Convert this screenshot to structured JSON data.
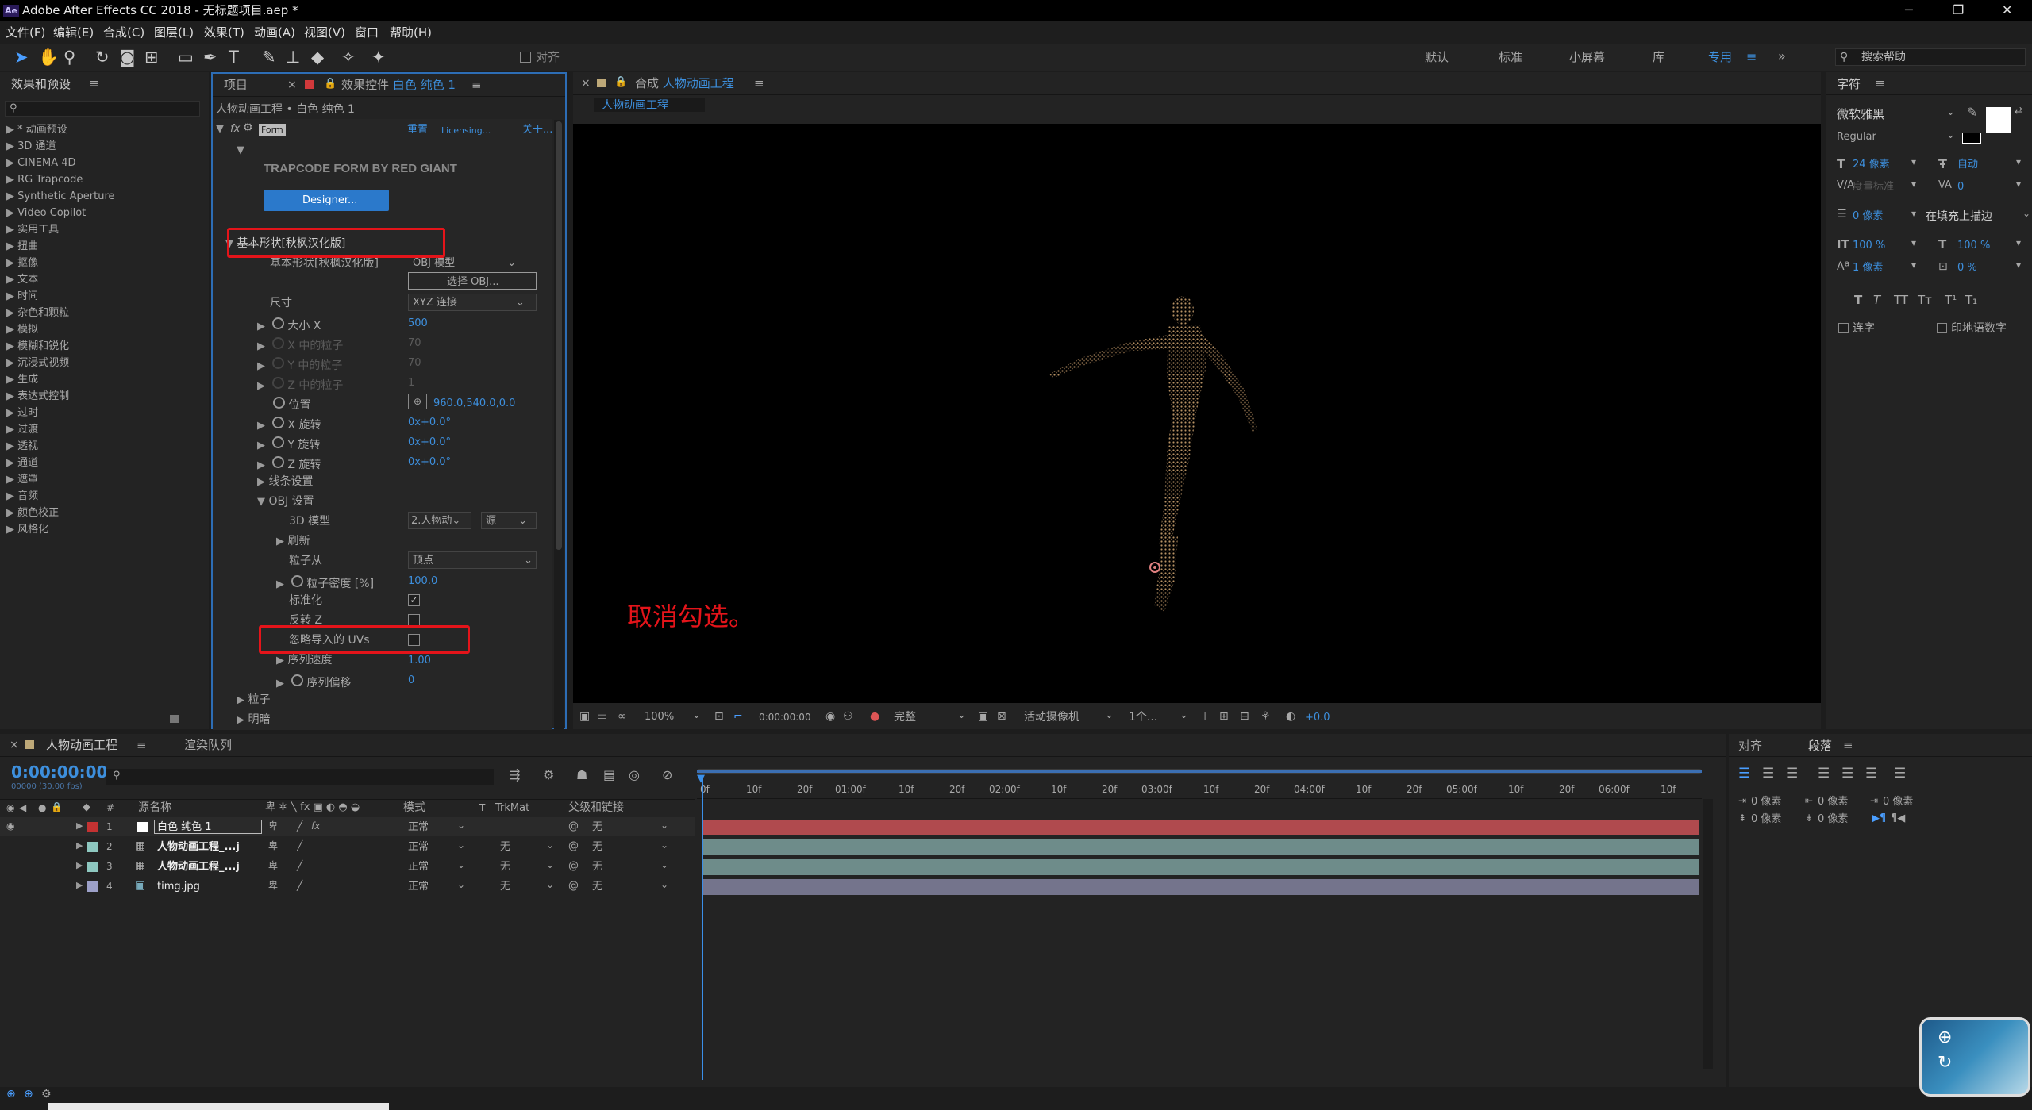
{
  "window": {
    "app_icon": "Ae",
    "title": "Adobe After Effects CC 2018 - 无标题项目.aep *",
    "minimize": "─",
    "maximize": "❐",
    "close": "✕"
  },
  "menu": [
    "文件(F)",
    "编辑(E)",
    "合成(C)",
    "图层(L)",
    "效果(T)",
    "动画(A)",
    "视图(V)",
    "窗口",
    "帮助(H)"
  ],
  "toolbar": {
    "align_label": "对齐",
    "workspaces": [
      "默认",
      "标准",
      "小屏幕",
      "库",
      "专用"
    ],
    "search_placeholder": "搜索帮助"
  },
  "effects_panel": {
    "title": "效果和预设",
    "categories": [
      "* 动画预设",
      "3D 通道",
      "CINEMA 4D",
      "RG Trapcode",
      "Synthetic Aperture",
      "Video Copilot",
      "实用工具",
      "扭曲",
      "抠像",
      "文本",
      "时间",
      "杂色和颗粒",
      "模拟",
      "模糊和锐化",
      "沉浸式视频",
      "生成",
      "表达式控制",
      "过时",
      "过渡",
      "透视",
      "通道",
      "遮罩",
      "音频",
      "颜色校正",
      "风格化"
    ]
  },
  "fx_panel": {
    "tab_project": "项目",
    "tab_effect": "效果控件",
    "tab_effect_layer": "白色 纯色 1",
    "breadcrumb": "人物动画工程 • 白色 纯色 1",
    "fx_label": "fx",
    "effect_name": "Form",
    "reset": "重置",
    "licensing": "Licensing...",
    "about": "关于...",
    "brand": "TRAPCODE FORM BY RED GIANT",
    "designer_button": "Designer...",
    "rows": {
      "base_form": "基本形状[秋枫汉化版]",
      "base_form_prop": "基本形状[秋枫汉化版]",
      "base_form_value": "OBJ 模型",
      "choose_obj": "选择 OBJ...",
      "size": "尺寸",
      "size_value": "XYZ 连接",
      "size_x": "大小 X",
      "size_x_value": "500",
      "px_x": "X 中的粒子",
      "px_x_value": "70",
      "px_y": "Y 中的粒子",
      "px_y_value": "70",
      "px_z": "Z 中的粒子",
      "px_z_value": "1",
      "position": "位置",
      "position_value": "960.0,540.0,0.0",
      "rot_x": "X 旋转",
      "rot_x_value": "0x+0.0°",
      "rot_y": "Y 旋转",
      "rot_y_value": "0x+0.0°",
      "rot_z": "Z 旋转",
      "rot_z_value": "0x+0.0°",
      "string_settings": "线条设置",
      "obj_settings": "OBJ 设置",
      "model_3d": "3D 模型",
      "model_3d_value": "2.人物动",
      "model_3d_source": "源",
      "refresh": "刷新",
      "particles_from": "粒子从",
      "particles_from_value": "顶点",
      "density": "粒子密度 [%]",
      "density_value": "100.0",
      "normalize": "标准化",
      "invert_z": "反转 Z",
      "ignore_uvs": "忽略导入的 UVs",
      "seq_speed": "序列速度",
      "seq_speed_value": "1.00",
      "seq_offset": "序列偏移",
      "seq_offset_value": "0",
      "particle": "粒子",
      "shading": "明暗"
    }
  },
  "comp_panel": {
    "tab_prefix": "合成",
    "comp_name": "人物动画工程",
    "comp_chip": "人物动画工程",
    "annotation": "取消勾选。",
    "zoom": "100%",
    "timecode": "0:00:00:00",
    "quality": "完整",
    "camera": "活动摄像机",
    "views": "1个...",
    "exposure": "+0.0"
  },
  "char_panel": {
    "title": "字符",
    "font": "微软雅黑",
    "style": "Regular",
    "size": "24 像素",
    "leading": "自动",
    "kerning": "度量标准",
    "tracking": "0",
    "stroke": "0 像素",
    "stroke_mode": "在填充上描边",
    "vscale": "100 %",
    "hscale": "100 %",
    "baseline": "1 像素",
    "tsume": "0 %",
    "ligature": "连字",
    "hindi": "印地语数字",
    "caps": [
      "T",
      "T",
      "TT",
      "Tт",
      "T¹",
      "T₁"
    ]
  },
  "timeline": {
    "tab_comp": "人物动画工程",
    "tab_render": "渲染队列",
    "timecode": "0:00:00:00",
    "fps": "00000 (30.00 fps)",
    "col_name": "源名称",
    "col_mode": "模式",
    "col_trk": "TrkMat",
    "col_parent": "父级和链接",
    "col_num": "#",
    "ruler": [
      "0f",
      "10f",
      "20f",
      "01:00f",
      "10f",
      "20f",
      "02:00f",
      "10f",
      "20f",
      "03:00f",
      "10f",
      "20f",
      "04:00f",
      "10f",
      "20f",
      "05:00f",
      "10f",
      "20f",
      "06:00f",
      "10f"
    ],
    "layers": [
      {
        "num": "1",
        "name": "白色 纯色 1",
        "mode": "正常",
        "trk": "",
        "parent": "无",
        "color": "#c43232",
        "bar": "#b04a4e"
      },
      {
        "num": "2",
        "name": "人物动画工程_...j",
        "mode": "正常",
        "trk": "无",
        "parent": "无",
        "color": "#8ec8c0",
        "bar": "#6e8c8a"
      },
      {
        "num": "3",
        "name": "人物动画工程_...j",
        "mode": "正常",
        "trk": "无",
        "parent": "无",
        "color": "#8ec8c0",
        "bar": "#6e8c8a"
      },
      {
        "num": "4",
        "name": "timg.jpg",
        "mode": "正常",
        "trk": "无",
        "parent": "无",
        "color": "#9ca0c8",
        "bar": "#74748c"
      }
    ]
  },
  "para_panel": {
    "tab_align": "对齐",
    "tab_para": "段落",
    "indent_left": "0 像素",
    "indent_right": "0 像素",
    "indent_first": "0 像素",
    "space_before": "0 像素",
    "space_after": "0 像素"
  }
}
